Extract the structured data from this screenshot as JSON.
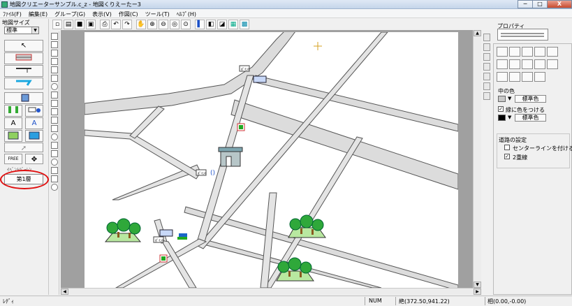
{
  "window": {
    "title": "地図クリエーターサンプル.c_z - 地図くりえーたー3",
    "minimize": "─",
    "maximize": "□",
    "close": "X"
  },
  "menu": [
    "ﾌｧｲﾙ(F)",
    "編集(E)",
    "グループ(G)",
    "表示(V)",
    "作図(C)",
    "ツール(T)",
    "ﾍﾙﾌﾟ(H)"
  ],
  "toolbar_icons": [
    "new-icon",
    "open-icon",
    "save-icon",
    "print-preview-icon",
    "print-icon",
    "undo-icon",
    "redo-icon",
    "pan-icon",
    "zoom-in-icon",
    "zoom-out-icon",
    "zoom-fit-icon",
    "zoom-area-icon",
    "layer-front-icon",
    "layer-back-icon",
    "fill-icon",
    "grid-icon",
    "table-icon"
  ],
  "left_panel": {
    "map_size_label": "地図サイズ",
    "map_size_value": "標準",
    "buttons": [
      "↖",
      "",
      "",
      "",
      "",
      "",
      "",
      "",
      "A",
      "A",
      "",
      "",
      "FREE",
      "✥"
    ],
    "layer_caption": "ｲﾍﾞﾝﾄﾊﾞｰﾚﾝ",
    "layer_button": "第1層"
  },
  "property_panel": {
    "title": "プロパティ",
    "fill_color_label": "中の色",
    "fill_color_button": "標準色",
    "border_color_check": "✓",
    "border_color_label": "縁に色をつける",
    "border_color_button": "標準色",
    "road_settings_label": "道路の設定",
    "centerline_label": "センターラインを付ける",
    "double_line_check": "✓",
    "double_line_label": "2重線"
  },
  "map_labels": {
    "coord_label_1": "ﾎﾟｲﾝﾄ",
    "coord_label_2": "ﾎﾟｲﾝﾄ",
    "coord_label_3": "ﾎﾟｲﾝﾄ"
  },
  "status": {
    "ready": "ﾚﾃﾞｨ",
    "num": "NUM",
    "abs_coords": "絶(372.50,941.22)",
    "rel_coords": "相(0.00,-0.00)"
  }
}
